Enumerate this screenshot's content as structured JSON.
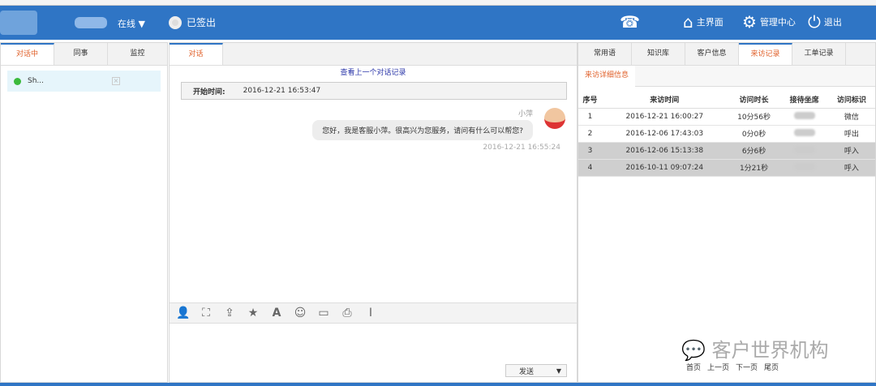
{
  "header": {
    "status": "在线",
    "signed_out": "已签出",
    "home": "主界面",
    "admin": "管理中心",
    "logout": "退出"
  },
  "left": {
    "tabs": [
      "对话中",
      "同事",
      "监控"
    ],
    "contacts": [
      {
        "name": "Sh..."
      }
    ]
  },
  "chat": {
    "tab": "对话",
    "prev_link": "查看上一个对话记录",
    "start_label": "开始时间:",
    "start_time": "2016-12-21 16:53:47",
    "message": {
      "sender": "小萍",
      "text": "您好，我是客服小萍。很高兴为您服务，请问有什么可以帮您?",
      "time": "2016-12-21 16:55:24"
    },
    "send": "发送"
  },
  "right": {
    "tabs": [
      "常用语",
      "知识库",
      "客户信息",
      "来访记录",
      "工单记录"
    ],
    "active_tab": "来访记录",
    "subtab": "来访详细信息",
    "columns": [
      "序号",
      "来访时间",
      "访问时长",
      "接待坐席",
      "访问标识"
    ],
    "rows": [
      [
        "1",
        "2016-12-21 16:00:27",
        "10分56秒",
        "",
        "微信"
      ],
      [
        "2",
        "2016-12-06 17:43:03",
        "0分0秒",
        "",
        "呼出"
      ],
      [
        "3",
        "2016-12-06 15:13:38",
        "6分6秒",
        "",
        "呼入"
      ],
      [
        "4",
        "2016-10-11 09:07:24",
        "1分21秒",
        "",
        "呼入"
      ]
    ],
    "pager": [
      "首页",
      "上一页",
      "下一页",
      "尾页"
    ]
  },
  "watermark": "客户世界机构",
  "colors": {
    "header": "#2f75c5",
    "active_tab": "#e0602a"
  }
}
